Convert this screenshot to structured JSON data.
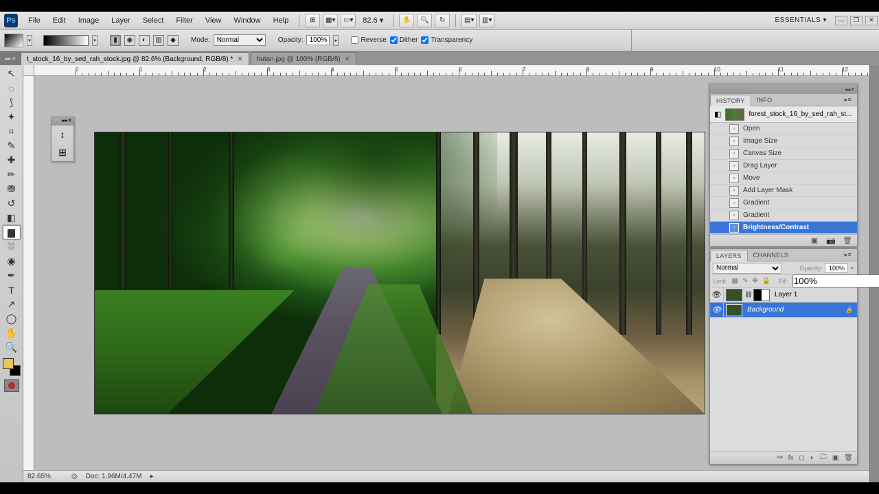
{
  "menubar": {
    "items": [
      "File",
      "Edit",
      "Image",
      "Layer",
      "Select",
      "Filter",
      "View",
      "Window",
      "Help"
    ],
    "zoom": "82.6",
    "workspace": "ESSENTIALS ▾"
  },
  "optbar": {
    "mode_label": "Mode:",
    "mode_value": "Normal",
    "opacity_label": "Opacity:",
    "opacity_value": "100%",
    "reverse": "Reverse",
    "dither": "Dither",
    "transparency": "Transparency"
  },
  "tabs": [
    {
      "label": "t_stock_16_by_sed_rah_stock.jpg @ 82.6% (Background, RGB/8) *",
      "active": true
    },
    {
      "label": "hutan.jpg @ 100% (RGB/8)",
      "active": false
    }
  ],
  "tools": [
    {
      "name": "move",
      "glyph": "↖"
    },
    {
      "name": "marquee",
      "glyph": "◌"
    },
    {
      "name": "lasso",
      "glyph": "⟆"
    },
    {
      "name": "wand",
      "glyph": "✦"
    },
    {
      "name": "crop",
      "glyph": "⌗"
    },
    {
      "name": "eyedropper",
      "glyph": "✎"
    },
    {
      "name": "heal",
      "glyph": "✚"
    },
    {
      "name": "brush",
      "glyph": "✏"
    },
    {
      "name": "stamp",
      "glyph": "⛃"
    },
    {
      "name": "history-brush",
      "glyph": "↺"
    },
    {
      "name": "eraser",
      "glyph": "◧"
    },
    {
      "name": "gradient",
      "glyph": "▆",
      "active": true
    },
    {
      "name": "blur",
      "glyph": "⛆"
    },
    {
      "name": "dodge",
      "glyph": "◉"
    },
    {
      "name": "pen",
      "glyph": "✒"
    },
    {
      "name": "type",
      "glyph": "T"
    },
    {
      "name": "path-sel",
      "glyph": "↗"
    },
    {
      "name": "shape",
      "glyph": "◯"
    },
    {
      "name": "hand",
      "glyph": "✋"
    },
    {
      "name": "zoom",
      "glyph": "🔍"
    }
  ],
  "history": {
    "tab1": "HISTORY",
    "tab2": "INFO",
    "doc": "forest_stock_16_by_sed_rah_st...",
    "items": [
      {
        "label": "Open"
      },
      {
        "label": "Image Size"
      },
      {
        "label": "Canvas Size"
      },
      {
        "label": "Drag Layer"
      },
      {
        "label": "Move"
      },
      {
        "label": "Add Layer Mask"
      },
      {
        "label": "Gradient"
      },
      {
        "label": "Gradient"
      },
      {
        "label": "Brightness/Contrast",
        "sel": true
      }
    ]
  },
  "layers": {
    "tab1": "LAYERS",
    "tab2": "CHANNELS",
    "blend": "Normal",
    "opacity_label": "Opacity:",
    "opacity": "100%",
    "fill_label": "Fill:",
    "fill": "100%",
    "lock_label": "Lock:",
    "list": [
      {
        "name": "Layer 1",
        "mask": true
      },
      {
        "name": "Background",
        "locked": true,
        "sel": true
      }
    ]
  },
  "status": {
    "zoom": "82.65%",
    "doc": "Doc: 1.96M/4.47M"
  },
  "ruler": {
    "marks": [
      0,
      1,
      2,
      3,
      4,
      5,
      6,
      7,
      8,
      9,
      10,
      11,
      12
    ]
  }
}
